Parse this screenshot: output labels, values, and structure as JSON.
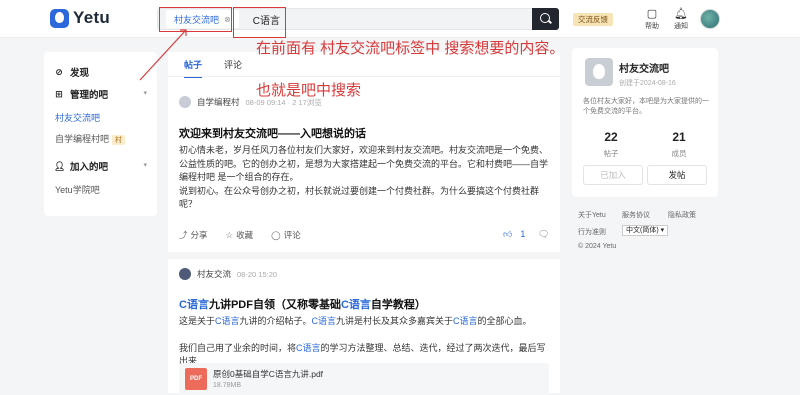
{
  "header": {
    "logo_text": "Yetu",
    "search": {
      "tag_label": "村友交流吧",
      "tag_remove": "⊗",
      "value": "C语言"
    },
    "feedback_label": "交流反馈",
    "help_label": "帮助",
    "notify_label": "通知"
  },
  "annotation": {
    "line1": "在前面有 村友交流吧标签中  搜索想要的内容。",
    "line2": "也就是吧中搜索",
    "color": "#d83a3a"
  },
  "sidebar": {
    "discover": "发现",
    "managed": "管理的吧",
    "managed_items": [
      {
        "label": "村友交流吧"
      },
      {
        "label": "自学编程村吧",
        "badge": "村"
      }
    ],
    "joined": "加入的吧",
    "joined_items": [
      {
        "label": "Yetu学院吧"
      }
    ]
  },
  "feed": {
    "tabs": [
      "帖子",
      "评论"
    ],
    "posts": [
      {
        "author": "自学编程村",
        "time": "08-09 09:14 · 2 17浏览",
        "title": "欢迎来到村友交流吧——入吧想说的话",
        "body": [
          "初心情未老，岁月任风刀各位村友们大家好，欢迎来到村友交流吧。村友交流吧是一个免费、",
          "公益性质的吧。它的创办之初，是想为大家搭建起一个免费交流的平台。它和村费吧——自学",
          "编程村吧 是一个组合的存在。",
          "说到初心。在公众号创办之初，村长就说过要创建一个付费社群。为什么要搞这个付费社群",
          "呢？"
        ],
        "actions": {
          "share": "分享",
          "collect": "收藏",
          "comment": "评论"
        },
        "likes": "1"
      },
      {
        "author": "村友交流",
        "time": "08-20 15:20",
        "title_parts": [
          {
            "text": "C语言",
            "hl": true
          },
          {
            "text": "九讲PDF自领（又称零基础",
            "hl": false
          },
          {
            "text": "C语言",
            "hl": true
          },
          {
            "text": "自学教程）",
            "hl": false
          }
        ],
        "line1_parts": [
          {
            "text": "这是关于",
            "hl": false
          },
          {
            "text": "C语言",
            "hl": true
          },
          {
            "text": "九讲的介绍帖子。",
            "hl": false
          },
          {
            "text": "C语言",
            "hl": true
          },
          {
            "text": "九讲是村长及其众多嘉宾关于",
            "hl": false
          },
          {
            "text": "C语言",
            "hl": true
          },
          {
            "text": "的全部心血。",
            "hl": false
          }
        ],
        "line2_parts": [
          {
            "text": "我们自己用了业余的时间，将",
            "hl": false
          },
          {
            "text": "C语言",
            "hl": true
          },
          {
            "text": "的学习方法整理、总结、迭代，经过了两次迭代，最后写出来...",
            "hl": false
          }
        ],
        "attachment": {
          "icon": "PDF",
          "name": "原创0基础自学C语言九讲.pdf",
          "size": "18.78MB"
        }
      }
    ]
  },
  "right_card": {
    "name": "村友交流吧",
    "created": "创建于2024-08-16",
    "desc": "各位村友大家好，本吧是为大家提供的一个免费交流的平台。",
    "posts_count": "22",
    "posts_label": "帖子",
    "members_count": "21",
    "members_label": "成员",
    "joined_btn": "已加入",
    "post_btn": "发帖"
  },
  "footer": {
    "links": [
      "关于Yetu",
      "服务协议",
      "隐私政策",
      "行为准则"
    ],
    "language": "中文(简体)",
    "copyright": "© 2024 Yetu"
  }
}
